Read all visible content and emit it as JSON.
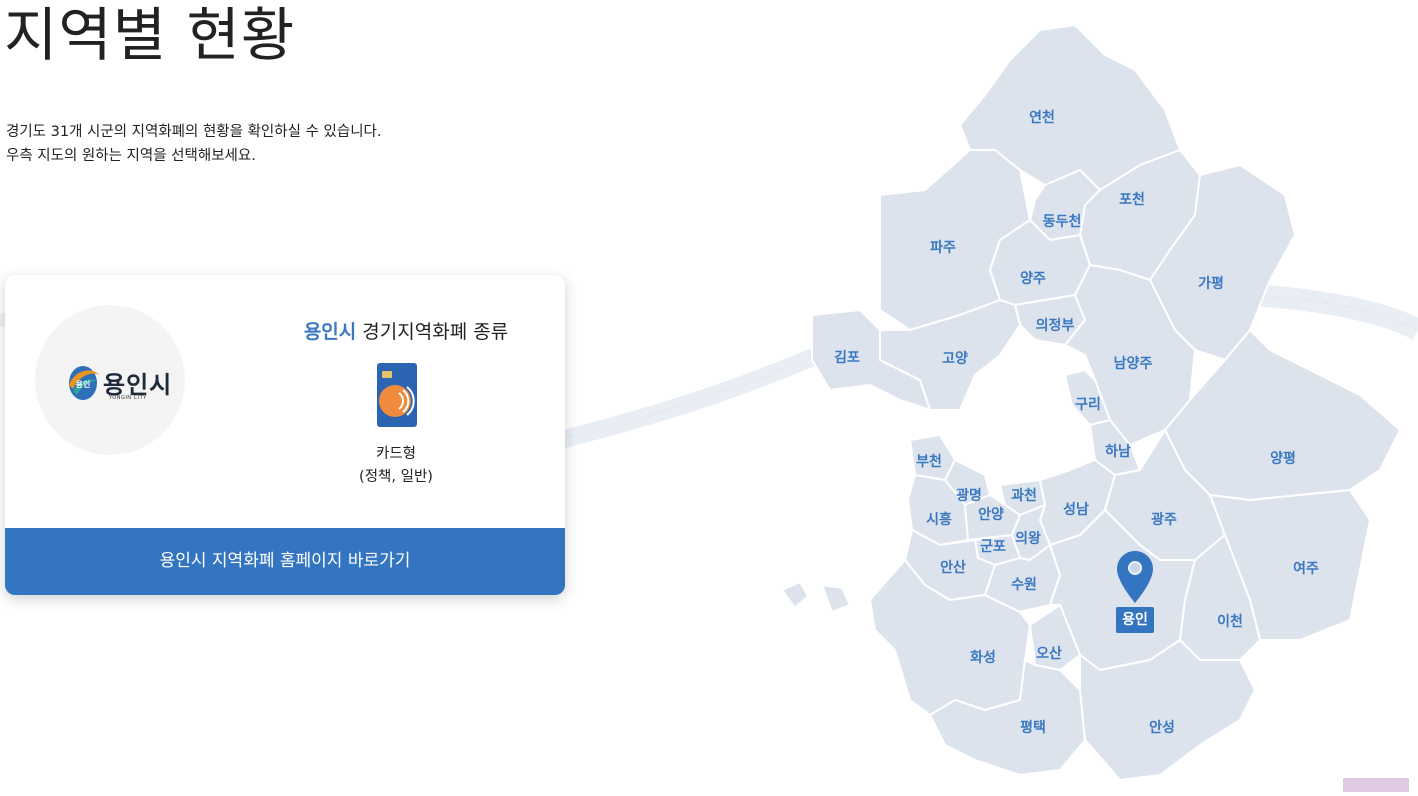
{
  "page": {
    "title": "지역별 현황",
    "description_line1": "경기도 31개 시군의 지역화폐의 현황을 확인하실 수 있습니다.",
    "description_line2": "우측 지도의 원하는 지역을 선택해보세요."
  },
  "card": {
    "logo_text": "용인시",
    "logo_subtext": "YONGIN CITY",
    "heading_city": "용인시",
    "heading_rest": " 경기지역화폐 종류",
    "type_line1": "카드형",
    "type_line2": "(정책, 일반)",
    "button_label": "용인시 지역화폐 홈페이지 바로가기"
  },
  "map": {
    "regions": [
      "연천",
      "포천",
      "동두천",
      "파주",
      "양주",
      "가평",
      "의정부",
      "김포",
      "고양",
      "남양주",
      "구리",
      "하남",
      "부천",
      "양평",
      "광명",
      "과천",
      "성남",
      "시흥",
      "안양",
      "광주",
      "군포",
      "의왕",
      "안산",
      "여주",
      "수원",
      "이천",
      "화성",
      "오산",
      "평택",
      "안성"
    ],
    "selected": "용인"
  },
  "colors": {
    "accent": "#3475c1",
    "region_fill": "#dde3ec",
    "region_stroke": "#ffffff",
    "label": "#3a78c2"
  }
}
